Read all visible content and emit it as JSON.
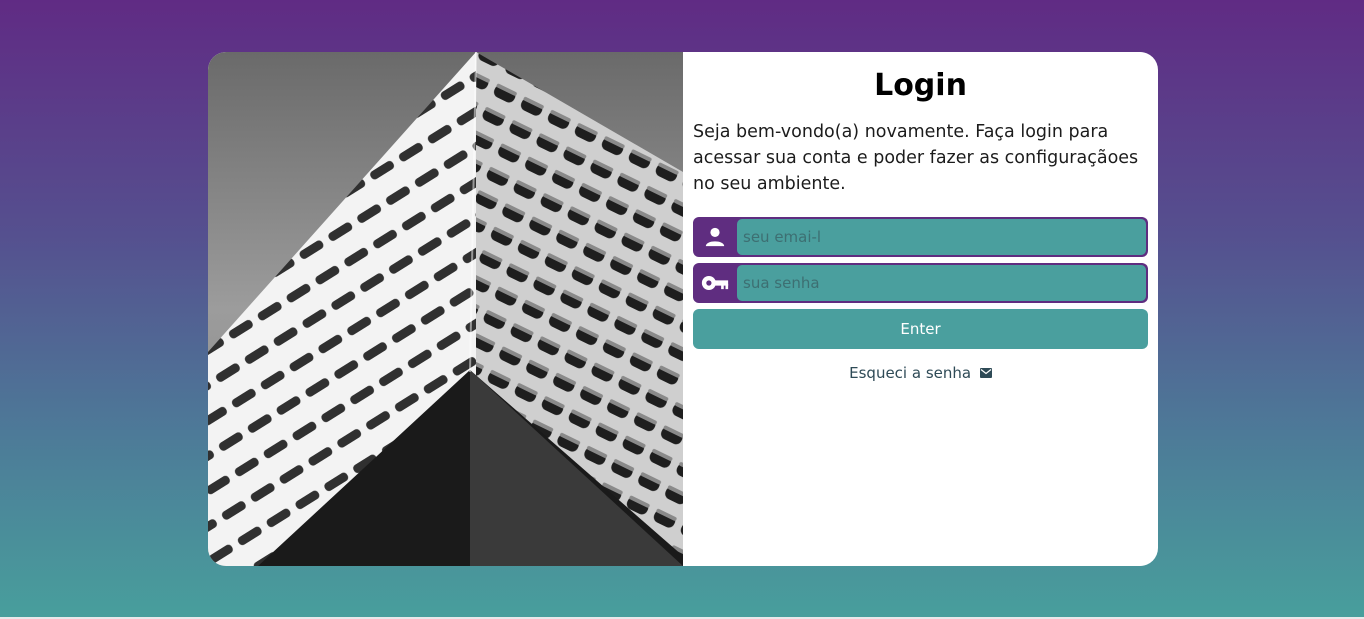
{
  "login": {
    "title": "Login",
    "description": "Seja bem-vondo(a) novamente. Faça login para acessar sua conta e poder fazer as configuraçãoes no seu ambiente.",
    "email_placeholder": "seu emai-l",
    "password_placeholder": "sua senha",
    "enter_label": "Enter",
    "forgot_label": "Esqueci a senha"
  },
  "icons": {
    "email": "user-icon",
    "password": "key-icon",
    "forgot": "mail-icon"
  },
  "colors": {
    "purple": "#5f2d80",
    "teal": "#4a9f9e"
  }
}
